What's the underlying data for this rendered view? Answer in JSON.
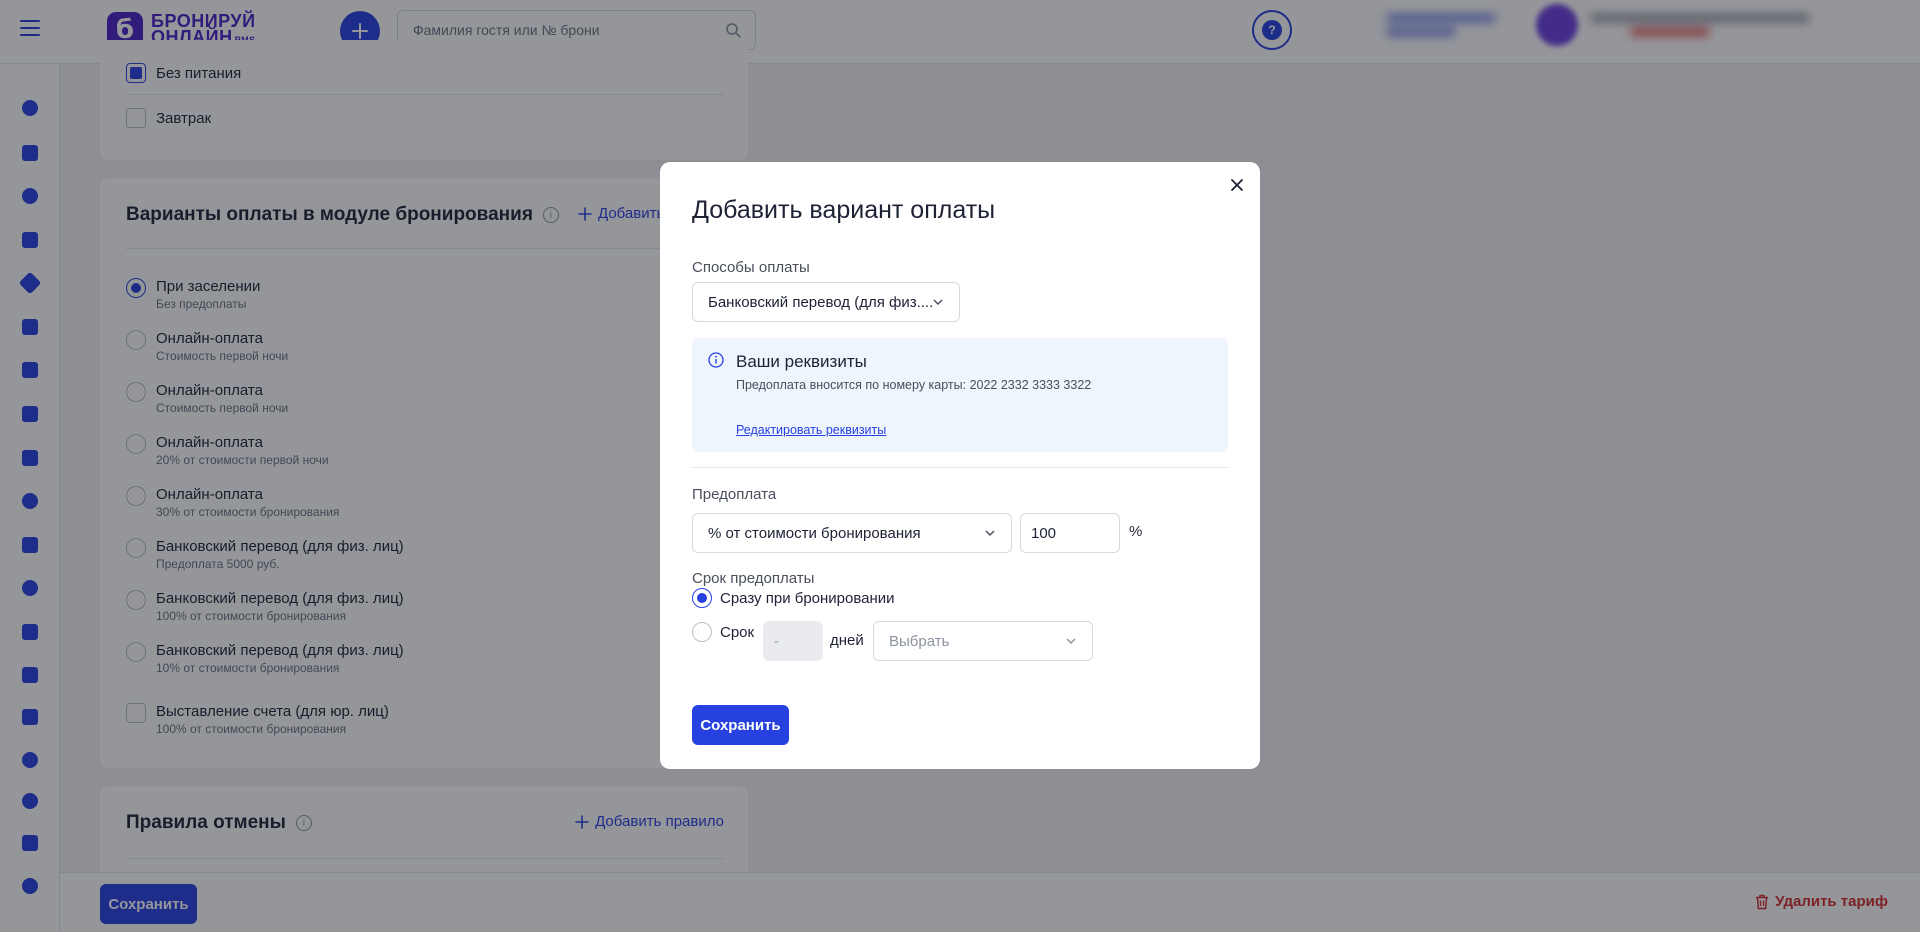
{
  "topbar": {
    "logo_line1": "БРОНИРУЙ",
    "logo_line2": "ОНЛАЙН",
    "logo_suffix": "PMS",
    "logo_mark": "б",
    "search_placeholder": "Фамилия гостя или № брони",
    "help_label": "?"
  },
  "meals": {
    "items": [
      {
        "label": "Без питания",
        "checked": true
      },
      {
        "label": "Завтрак",
        "checked": false
      }
    ]
  },
  "payment_section": {
    "title": "Варианты оплаты в модуле бронирования",
    "add_label": "Добавить",
    "options": [
      {
        "title": "При заселении",
        "subtitle": "Без предоплаты",
        "selected": true
      },
      {
        "title": "Онлайн-оплата",
        "subtitle": "Стоимость первой ночи"
      },
      {
        "title": "Онлайн-оплата",
        "subtitle": "Стоимость первой ночи"
      },
      {
        "title": "Онлайн-оплата",
        "subtitle": "20% от стоимости первой ночи"
      },
      {
        "title": "Онлайн-оплата",
        "subtitle": "30% от стоимости бронирования"
      },
      {
        "title": "Банковский перевод (для физ. лиц)",
        "subtitle": "Предоплата 5000 руб."
      },
      {
        "title": "Банковский перевод (для физ. лиц)",
        "subtitle": "100% от стоимости бронирования"
      },
      {
        "title": "Банковский перевод (для физ. лиц)",
        "subtitle": "10% от стоимости бронирования"
      },
      {
        "title": "Выставление счета (для юр. лиц)",
        "subtitle": "100% от стоимости бронирования"
      }
    ]
  },
  "cancel_section": {
    "title": "Правила отмены",
    "add_label": "Добавить правило"
  },
  "bottombar": {
    "save_label": "Сохранить",
    "delete_label": "Удалить тариф"
  },
  "modal": {
    "title": "Добавить вариант оплаты",
    "payment_methods_label": "Способы оплаты",
    "payment_method_value": "Банковский перевод (для физ....",
    "requisites": {
      "title": "Ваши реквизиты",
      "description": "Предоплата вносится по номеру карты: 2022 2332 3333 3322",
      "edit_link": "Редактировать реквизиты"
    },
    "prepayment_label": "Предоплата",
    "prepayment_type": "% от стоимости бронирования",
    "prepayment_value": "100",
    "prepayment_unit": "%",
    "deadline_label": "Срок предоплаты",
    "deadline_immediate": "Сразу при бронировании",
    "deadline_term": "Срок",
    "deadline_days_placeholder": "-",
    "deadline_days_unit": "дней",
    "deadline_select_placeholder": "Выбрать",
    "save_label": "Сохранить"
  },
  "colors": {
    "accent": "#2741e0",
    "brand": "#4a1fc7",
    "danger": "#d22d2d"
  }
}
